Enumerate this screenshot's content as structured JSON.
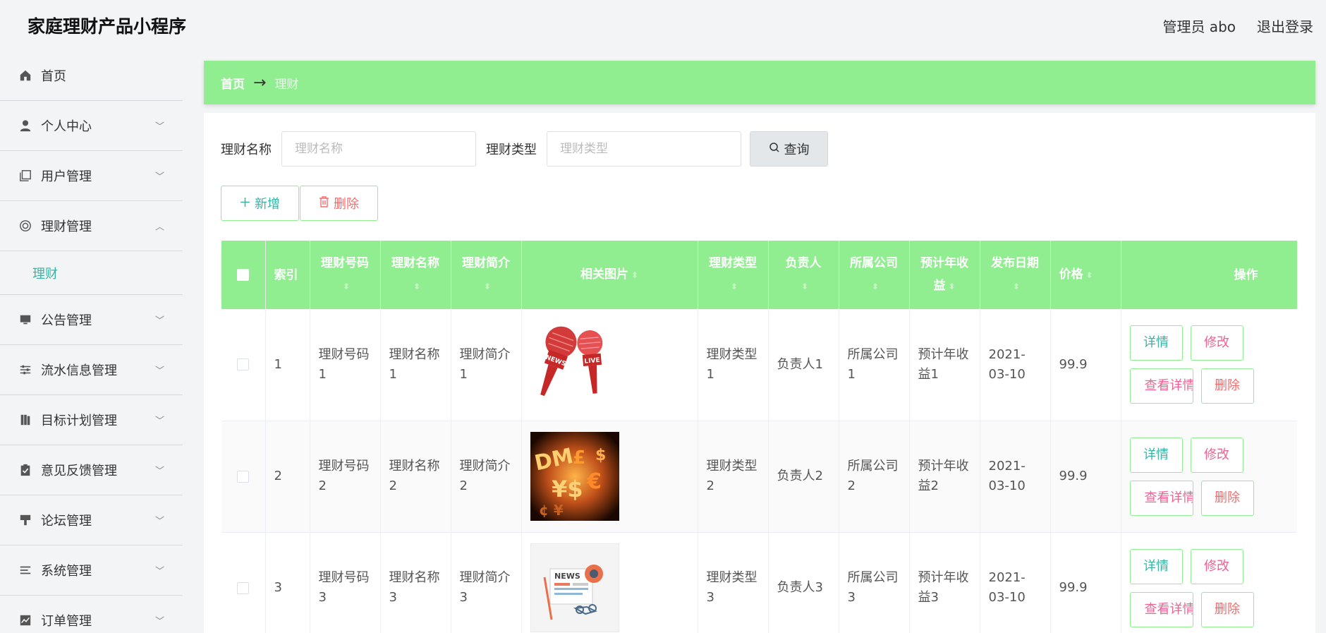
{
  "app": {
    "title": "家庭理财产品小程序"
  },
  "header": {
    "user": "管理员 abo",
    "logout": "退出登录"
  },
  "sidebar": {
    "items": [
      {
        "label": "首页",
        "icon": "home-icon",
        "expandable": false
      },
      {
        "label": "个人中心",
        "icon": "user-icon",
        "expandable": true
      },
      {
        "label": "用户管理",
        "icon": "copy-icon",
        "expandable": true
      },
      {
        "label": "理财管理",
        "icon": "lifebuoy-icon",
        "expandable": true,
        "expanded": true
      },
      {
        "label": "公告管理",
        "icon": "monitor-icon",
        "expandable": true
      },
      {
        "label": "流水信息管理",
        "icon": "sliders-icon",
        "expandable": true
      },
      {
        "label": "目标计划管理",
        "icon": "book-icon",
        "expandable": true
      },
      {
        "label": "意见反馈管理",
        "icon": "clipboard-icon",
        "expandable": true
      },
      {
        "label": "论坛管理",
        "icon": "brush-icon",
        "expandable": true
      },
      {
        "label": "系统管理",
        "icon": "list-icon",
        "expandable": true
      },
      {
        "label": "订单管理",
        "icon": "chart-icon",
        "expandable": true
      }
    ],
    "submenu_active": "理财"
  },
  "breadcrumb": {
    "home": "首页",
    "arrow": "→",
    "current": "理财"
  },
  "search": {
    "name_label": "理财名称",
    "name_placeholder": "理财名称",
    "type_label": "理财类型",
    "type_placeholder": "理财类型",
    "query_label": "查询"
  },
  "actions": {
    "add": "新增",
    "delete": "删除"
  },
  "table": {
    "headers": {
      "index": "索引",
      "code": "理财号码",
      "name": "理财名称",
      "intro": "理财简介",
      "image": "相关图片",
      "type": "理财类型",
      "owner": "负责人",
      "company": "所属公司",
      "yield": "预计年收益",
      "date": "发布日期",
      "price": "价格",
      "ops": "操作"
    },
    "rows": [
      {
        "index": "1",
        "code": "理财号码1",
        "name": "理财名称1",
        "intro": "理财简介1",
        "image": "microphone-news-live",
        "type": "理财类型1",
        "owner": "负责人1",
        "company": "所属公司1",
        "yield": "预计年收益1",
        "date": "2021-03-10",
        "price": "99.9"
      },
      {
        "index": "2",
        "code": "理财号码2",
        "name": "理财名称2",
        "intro": "理财简介2",
        "image": "currency-symbols-fire",
        "type": "理财类型2",
        "owner": "负责人2",
        "company": "所属公司2",
        "yield": "预计年收益2",
        "date": "2021-03-10",
        "price": "99.9"
      },
      {
        "index": "3",
        "code": "理财号码3",
        "name": "理财名称3",
        "intro": "理财简介3",
        "image": "newspaper-glasses",
        "type": "理财类型3",
        "owner": "负责人3",
        "company": "所属公司3",
        "yield": "预计年收益3",
        "date": "2021-03-10",
        "price": "99.9"
      }
    ],
    "row_actions": {
      "detail": "详情",
      "edit": "修改",
      "view": "查看详情",
      "delete": "删除"
    }
  },
  "colors": {
    "accent_green": "#90ee90",
    "teal": "#3bb3a3",
    "pink": "#f06292",
    "red": "#f56c6c"
  }
}
